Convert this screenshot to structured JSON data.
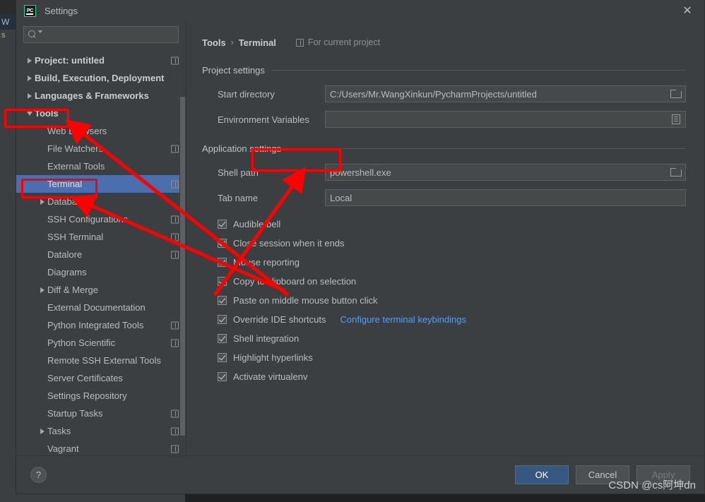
{
  "background_window": {
    "tab_letter": "W",
    "side_letter": "s"
  },
  "titlebar": {
    "logo_text": "PC",
    "title": "Settings",
    "close_icon": "✕"
  },
  "search": {
    "value": "",
    "placeholder": ""
  },
  "sidebar": {
    "items": [
      {
        "label": "Project: untitled",
        "indent": 0,
        "arrow": "right",
        "badge": true,
        "selected": false,
        "bold": true
      },
      {
        "label": "Build, Execution, Deployment",
        "indent": 0,
        "arrow": "right",
        "badge": false,
        "selected": false,
        "bold": true
      },
      {
        "label": "Languages & Frameworks",
        "indent": 0,
        "arrow": "right",
        "badge": false,
        "selected": false,
        "bold": true
      },
      {
        "label": "Tools",
        "indent": 0,
        "arrow": "down",
        "badge": false,
        "selected": false,
        "bold": true
      },
      {
        "label": "Web Browsers",
        "indent": 1,
        "arrow": "none",
        "badge": false,
        "selected": false,
        "bold": false
      },
      {
        "label": "File Watchers",
        "indent": 1,
        "arrow": "none",
        "badge": true,
        "selected": false,
        "bold": false
      },
      {
        "label": "External Tools",
        "indent": 1,
        "arrow": "none",
        "badge": false,
        "selected": false,
        "bold": false
      },
      {
        "label": "Terminal",
        "indent": 1,
        "arrow": "none",
        "badge": true,
        "selected": true,
        "bold": false
      },
      {
        "label": "Database",
        "indent": 1,
        "arrow": "right",
        "badge": false,
        "selected": false,
        "bold": false
      },
      {
        "label": "SSH Configurations",
        "indent": 1,
        "arrow": "none",
        "badge": true,
        "selected": false,
        "bold": false
      },
      {
        "label": "SSH Terminal",
        "indent": 1,
        "arrow": "none",
        "badge": true,
        "selected": false,
        "bold": false
      },
      {
        "label": "Datalore",
        "indent": 1,
        "arrow": "none",
        "badge": true,
        "selected": false,
        "bold": false
      },
      {
        "label": "Diagrams",
        "indent": 1,
        "arrow": "none",
        "badge": false,
        "selected": false,
        "bold": false
      },
      {
        "label": "Diff & Merge",
        "indent": 1,
        "arrow": "right",
        "badge": false,
        "selected": false,
        "bold": false
      },
      {
        "label": "External Documentation",
        "indent": 1,
        "arrow": "none",
        "badge": false,
        "selected": false,
        "bold": false
      },
      {
        "label": "Python Integrated Tools",
        "indent": 1,
        "arrow": "none",
        "badge": true,
        "selected": false,
        "bold": false
      },
      {
        "label": "Python Scientific",
        "indent": 1,
        "arrow": "none",
        "badge": true,
        "selected": false,
        "bold": false
      },
      {
        "label": "Remote SSH External Tools",
        "indent": 1,
        "arrow": "none",
        "badge": false,
        "selected": false,
        "bold": false
      },
      {
        "label": "Server Certificates",
        "indent": 1,
        "arrow": "none",
        "badge": false,
        "selected": false,
        "bold": false
      },
      {
        "label": "Settings Repository",
        "indent": 1,
        "arrow": "none",
        "badge": false,
        "selected": false,
        "bold": false
      },
      {
        "label": "Startup Tasks",
        "indent": 1,
        "arrow": "none",
        "badge": true,
        "selected": false,
        "bold": false
      },
      {
        "label": "Tasks",
        "indent": 1,
        "arrow": "right",
        "badge": true,
        "selected": false,
        "bold": false
      },
      {
        "label": "Vagrant",
        "indent": 1,
        "arrow": "none",
        "badge": true,
        "selected": false,
        "bold": false
      }
    ]
  },
  "content": {
    "breadcrumb": {
      "parent": "Tools",
      "separator": "›",
      "current": "Terminal"
    },
    "for_current_project": "For current project",
    "project_settings": {
      "title": "Project settings",
      "fields": [
        {
          "label": "Start directory",
          "value": "C:/Users/Mr.WangXinkun/PycharmProjects/untitled",
          "trailing_icon": "folder-icon"
        },
        {
          "label": "Environment Variables",
          "value": "",
          "trailing_icon": "env-vars-icon"
        }
      ]
    },
    "application_settings": {
      "title": "Application settings",
      "fields": [
        {
          "label": "Shell path",
          "value": "powershell.exe",
          "trailing_icon": "folder-icon"
        },
        {
          "label": "Tab name",
          "value": "Local",
          "trailing_icon": "none"
        }
      ],
      "checkboxes": [
        {
          "label": "Audible bell",
          "checked": true,
          "link": ""
        },
        {
          "label": "Close session when it ends",
          "checked": true,
          "link": ""
        },
        {
          "label": "Mouse reporting",
          "checked": true,
          "link": ""
        },
        {
          "label": "Copy to clipboard on selection",
          "checked": true,
          "link": ""
        },
        {
          "label": "Paste on middle mouse button click",
          "checked": true,
          "link": ""
        },
        {
          "label": "Override IDE shortcuts",
          "checked": true,
          "link": "Configure terminal keybindings"
        },
        {
          "label": "Shell integration",
          "checked": true,
          "link": ""
        },
        {
          "label": "Highlight hyperlinks",
          "checked": true,
          "link": ""
        },
        {
          "label": "Activate virtualenv",
          "checked": true,
          "link": ""
        }
      ]
    }
  },
  "footer": {
    "help_label": "?",
    "ok_label": "OK",
    "cancel_label": "Cancel",
    "apply_label": "Apply",
    "watermark": "CSDN @cs阿坤dn"
  },
  "colors": {
    "accent_selection": "#4b6eaf",
    "primary_button": "#365880",
    "link": "#589df6",
    "annotation_red": "#fe0000",
    "panel_bg": "#3c3f41",
    "field_bg": "#45494a",
    "logo_green": "#21d789"
  }
}
